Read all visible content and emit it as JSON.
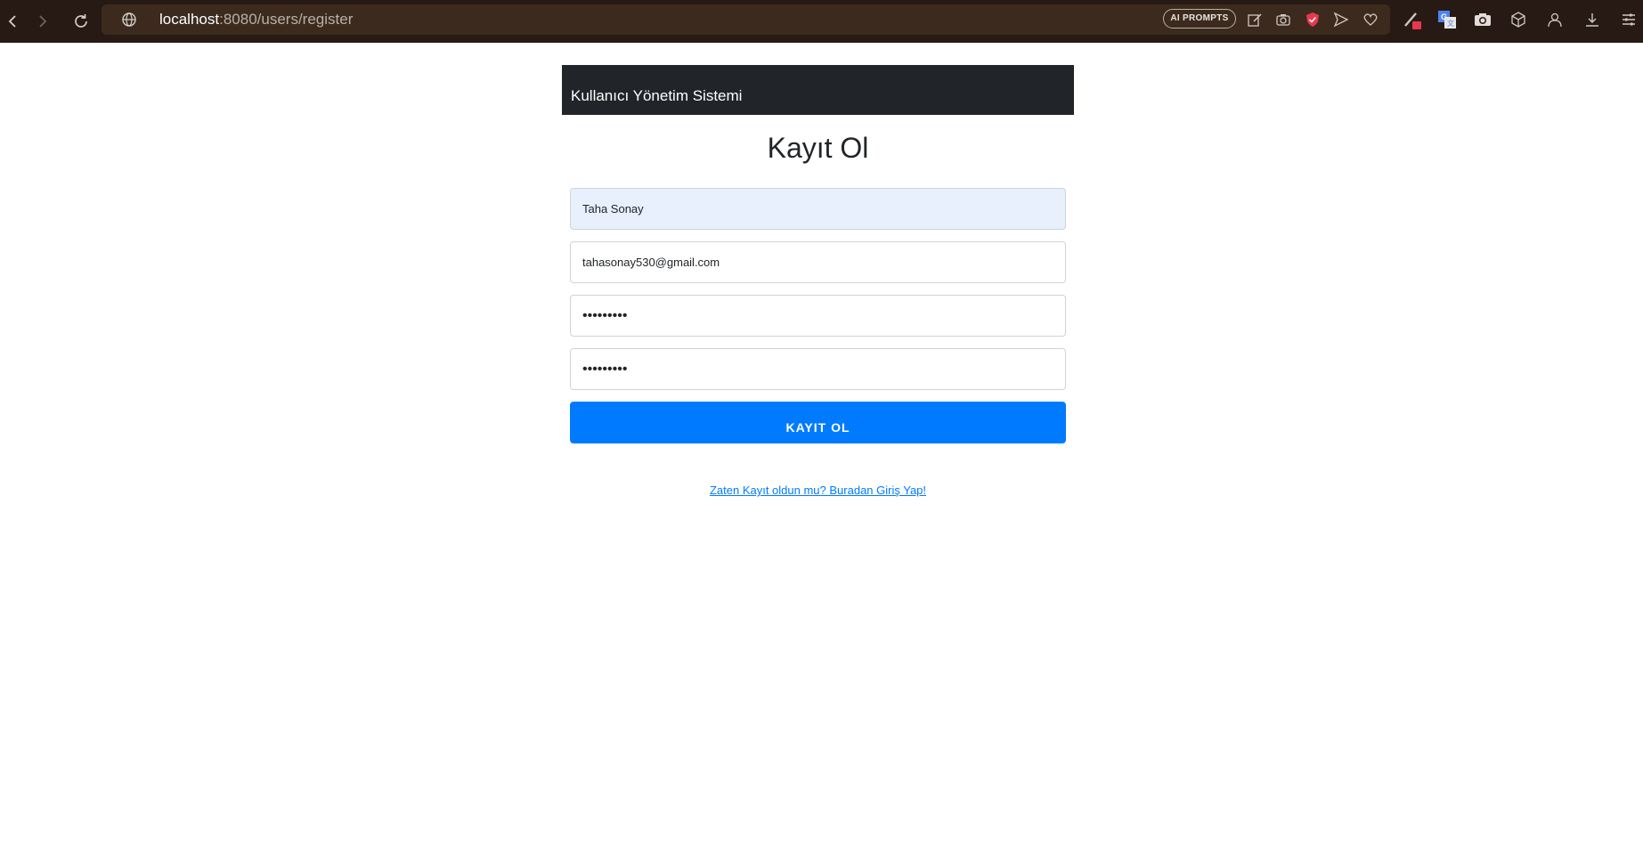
{
  "browser": {
    "url_host": "localhost",
    "url_rest": ":8080/users/register",
    "ai_prompts_label": "AI PROMPTS",
    "toolbar_icons": [
      "edit-icon",
      "camera-icon",
      "shield-icon",
      "send-icon",
      "heart-icon",
      "extension-pen-icon",
      "translate-icon",
      "screenshot-icon",
      "cube-icon",
      "profile-icon",
      "download-icon",
      "menu-icon"
    ]
  },
  "navbar": {
    "brand": "Kullanıcı Yönetim Sistemi"
  },
  "page": {
    "title": "Kayıt Ol"
  },
  "form": {
    "name_value": "Taha Sonay",
    "email_value": "tahasonay530@gmail.com",
    "password_value": "•••••••••",
    "confirm_password_value": "•••••••••",
    "submit_label": "KAYIT OL"
  },
  "footer": {
    "login_link": "Zaten Kayıt oldun mu? Buradan Giriş Yap!"
  },
  "colors": {
    "navbar_bg": "#212529",
    "primary": "#007bff",
    "autofill_bg": "#e8f0fe",
    "browser_bg": "#271a14"
  }
}
